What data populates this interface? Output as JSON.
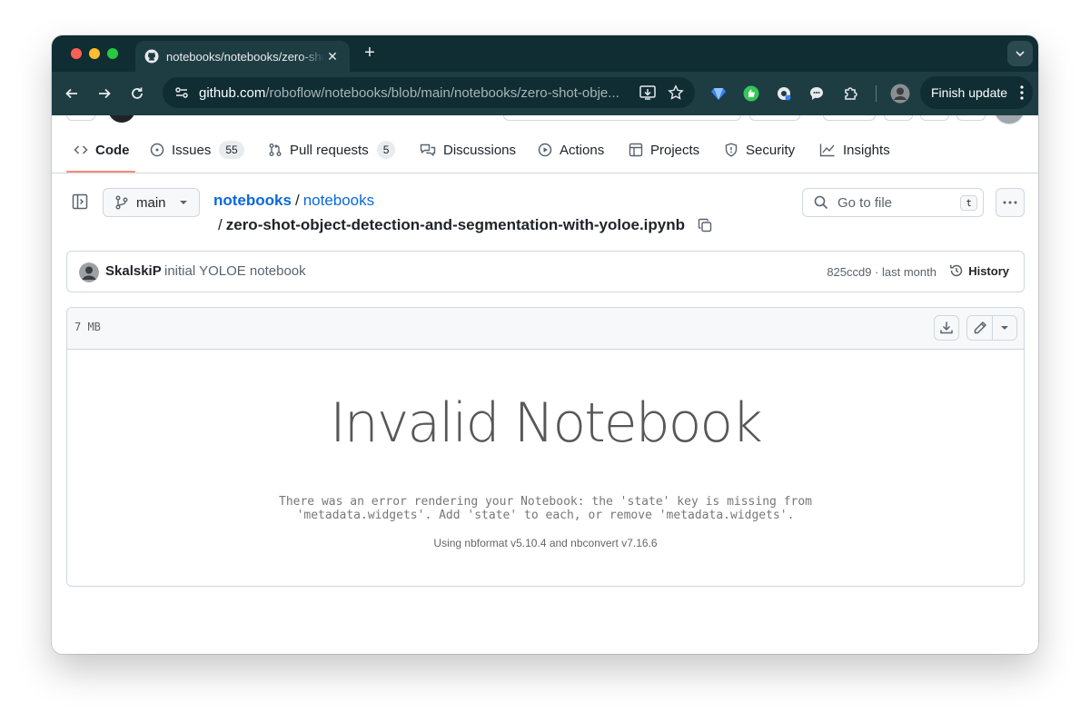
{
  "browser": {
    "tab": {
      "title": "notebooks/notebooks/zero-shot-object-detection-and-segmentation-with-yoloe.ipynb",
      "favicon": "github-icon"
    },
    "url": {
      "host": "github.com",
      "path": "/roboflow/notebooks/blob/main/notebooks/zero-shot-obje..."
    },
    "finish_update_label": "Finish update",
    "colors": {
      "frame": "#0f2d33",
      "toolbar": "#1e3d43"
    }
  },
  "repo_nav": {
    "items": [
      {
        "label": "Code",
        "icon": "code-icon",
        "active": true
      },
      {
        "label": "Issues",
        "icon": "issue-icon",
        "count": "55"
      },
      {
        "label": "Pull requests",
        "icon": "pull-request-icon",
        "count": "5"
      },
      {
        "label": "Discussions",
        "icon": "discussion-icon"
      },
      {
        "label": "Actions",
        "icon": "play-icon"
      },
      {
        "label": "Projects",
        "icon": "table-icon"
      },
      {
        "label": "Security",
        "icon": "shield-icon"
      },
      {
        "label": "Insights",
        "icon": "graph-icon"
      }
    ],
    "active_color": "#fd8c73"
  },
  "file_nav": {
    "branch": "main",
    "breadcrumb": {
      "owner": "notebooks",
      "separator": "/",
      "folder": "notebooks"
    },
    "filename_separator": "/",
    "filename": "zero-shot-object-detection-and-segmentation-with-yoloe.ipynb",
    "go_to_file_placeholder": "Go to file",
    "go_to_file_shortcut": "t"
  },
  "commit": {
    "author": "SkalskiP",
    "message": "initial YOLOE notebook",
    "meta": "825ccd9 · last month",
    "history_label": "History"
  },
  "file": {
    "size": "7 MB",
    "notebook_title": "Invalid Notebook",
    "error_line1": "There was an error rendering your Notebook: the 'state' key is missing from",
    "error_line2": "'metadata.widgets'. Add 'state' to each, or remove 'metadata.widgets'.",
    "version_info": "Using nbformat v5.10.4 and nbconvert v7.16.6"
  }
}
